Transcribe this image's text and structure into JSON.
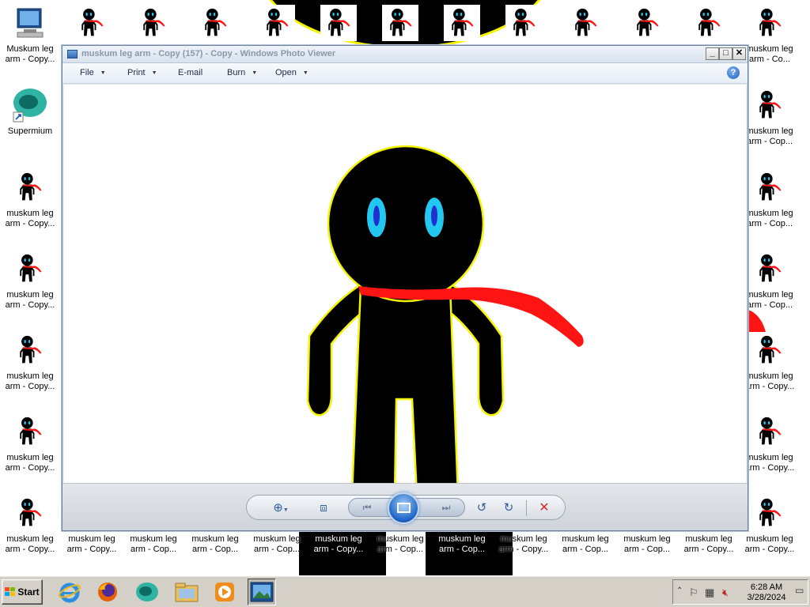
{
  "window": {
    "title": "muskum leg arm - Copy (157) - Copy - Windows Photo Viewer",
    "minimize": "_",
    "maximize": "□",
    "close": "✕"
  },
  "menu": {
    "items": [
      {
        "label": "File",
        "icon": "chevron-down-icon"
      },
      {
        "label": "Print",
        "icon": "chevron-down-icon"
      },
      {
        "label": "E-mail"
      },
      {
        "label": "Burn",
        "icon": "chevron-down-icon"
      },
      {
        "label": "Open",
        "icon": "chevron-down-icon"
      }
    ],
    "help": "?"
  },
  "toolbar": {
    "zoom": "zoom-icon",
    "fit": "actual-size-icon",
    "previous": "previous-icon",
    "slideshow": "slideshow-icon",
    "next": "next-icon",
    "rotate_ccw": "rotate-counterclockwise-icon",
    "rotate_cw": "rotate-clockwise-icon",
    "delete": "delete-icon",
    "delete_color": "#d42b2b"
  },
  "desktop": {
    "computer_label": "Computer",
    "overlap_label": "Muskum leg arm - Copy...",
    "supermium_label": "Supermium",
    "icon_label_two_line": [
      "muskum leg",
      "arm - Co..."
    ],
    "icon_label_two_line_b": [
      "muskum leg",
      "arm - Copy..."
    ],
    "icon_label_two_line_c": [
      "muskum leg",
      "arm - Cop..."
    ],
    "bottom_labels": [
      [
        "muskum leg",
        "arm - Copy..."
      ],
      [
        "muskum leg",
        "arm - Cop..."
      ],
      [
        "muskum leg",
        "arm - Cop..."
      ],
      [
        "muskum leg",
        "arm - Cop..."
      ],
      [
        "muskum leg",
        "arm - Copy..."
      ],
      [
        "muskum leg",
        "arm - Cop..."
      ],
      [
        "muskum leg",
        "arm - Cop..."
      ],
      [
        "muskum leg",
        "arm - Copy..."
      ],
      [
        "muskum leg",
        "arm - Cop..."
      ],
      [
        "muskum leg",
        "arm - Cop..."
      ],
      [
        "muskum leg",
        "arm - Copy..."
      ],
      [
        "muskum leg",
        "arm - Copy..."
      ]
    ]
  },
  "taskbar": {
    "start_label": "Start",
    "apps": [
      "internet-explorer-icon",
      "firefox-icon",
      "supermium-icon",
      "file-explorer-icon",
      "media-player-icon",
      "photo-viewer-icon"
    ],
    "time": "6:28 AM",
    "date": "3/28/2024"
  },
  "colors": {
    "figure": "#000000",
    "outline": "#f4f400",
    "eyes": "#22c8f0",
    "pupils": "#2030d0",
    "scarf": "#ff1414"
  }
}
